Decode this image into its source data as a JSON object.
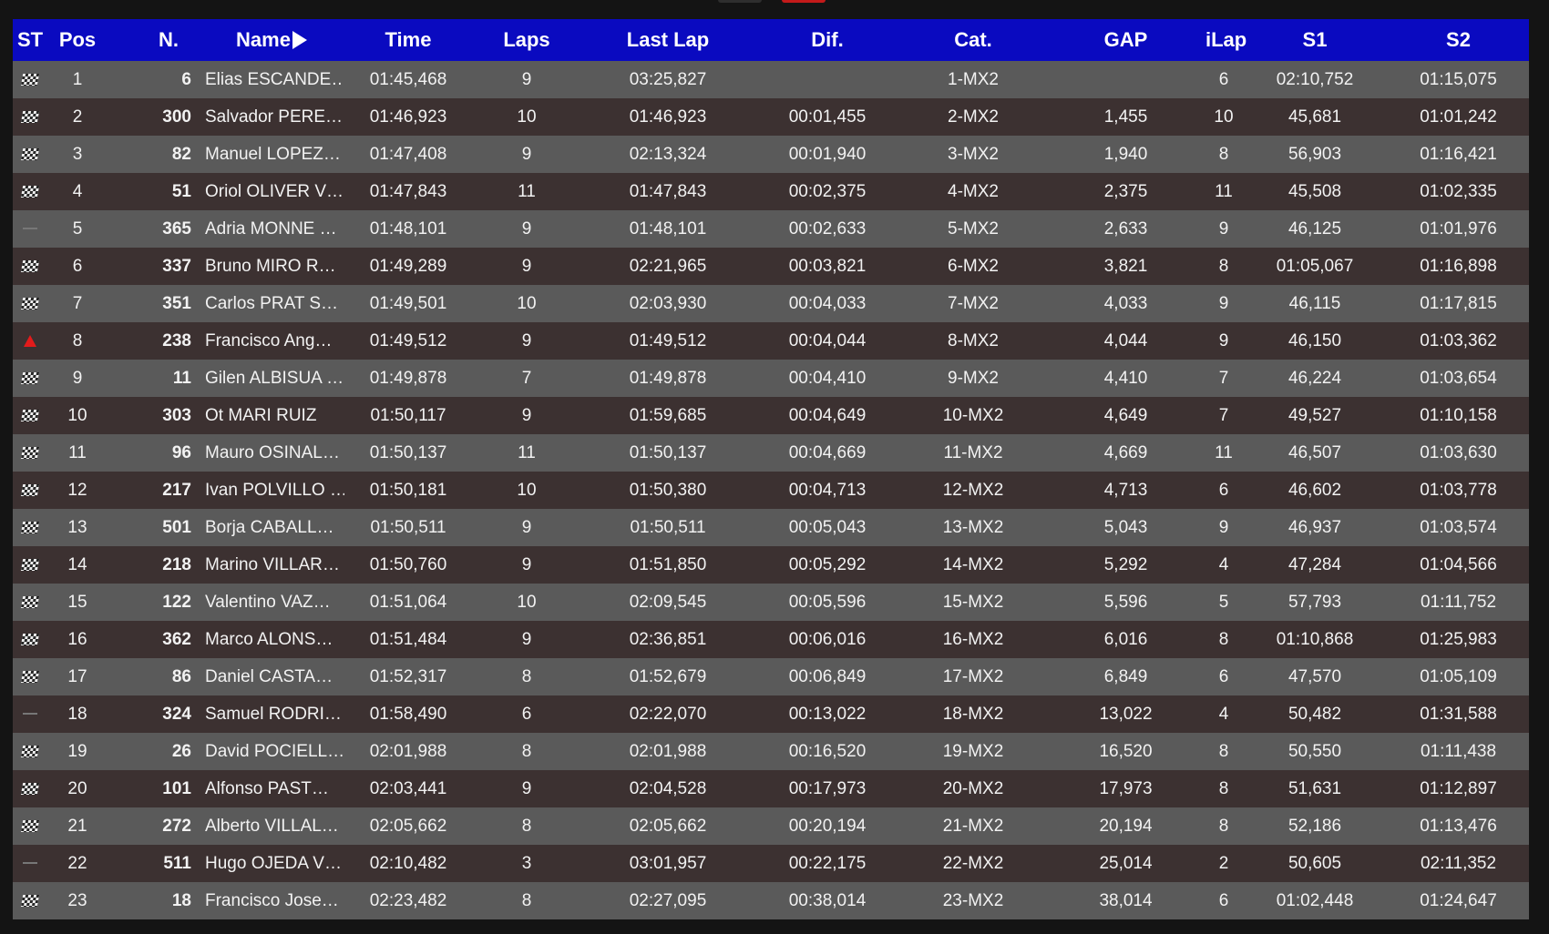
{
  "columns": {
    "st": "ST",
    "pos": "Pos",
    "num": "N.",
    "name": "Name",
    "time": "Time",
    "laps": "Laps",
    "lastlap": "Last Lap",
    "dif": "Dif.",
    "cat": "Cat.",
    "gap": "GAP",
    "ilap": "iLap",
    "s1": "S1",
    "s2": "S2"
  },
  "sort": {
    "column": "name",
    "icon": "sort-arrow-right-icon"
  },
  "colors": {
    "header_bg": "#0a0ac0",
    "row_light": "#5a5a5a",
    "row_dark": "#3c3131",
    "up_arrow": "#e31b1b"
  },
  "rows": [
    {
      "st": "flag",
      "pos": "1",
      "num": "6",
      "name": "Elias ESCANDE…",
      "time": "01:45,468",
      "laps": "9",
      "lastlap": "03:25,827",
      "dif": "",
      "cat": "1-MX2",
      "gap": "",
      "ilap": "6",
      "s1": "02:10,752",
      "s2": "01:15,075"
    },
    {
      "st": "flag",
      "pos": "2",
      "num": "300",
      "name": "Salvador PERE…",
      "time": "01:46,923",
      "laps": "10",
      "lastlap": "01:46,923",
      "dif": "00:01,455",
      "cat": "2-MX2",
      "gap": "1,455",
      "ilap": "10",
      "s1": "45,681",
      "s2": "01:01,242"
    },
    {
      "st": "flag",
      "pos": "3",
      "num": "82",
      "name": "Manuel LOPEZ…",
      "time": "01:47,408",
      "laps": "9",
      "lastlap": "02:13,324",
      "dif": "00:01,940",
      "cat": "3-MX2",
      "gap": "1,940",
      "ilap": "8",
      "s1": "56,903",
      "s2": "01:16,421"
    },
    {
      "st": "flag",
      "pos": "4",
      "num": "51",
      "name": "Oriol OLIVER V…",
      "time": "01:47,843",
      "laps": "11",
      "lastlap": "01:47,843",
      "dif": "00:02,375",
      "cat": "4-MX2",
      "gap": "2,375",
      "ilap": "11",
      "s1": "45,508",
      "s2": "01:02,335"
    },
    {
      "st": "dash",
      "pos": "5",
      "num": "365",
      "name": "Adria MONNE …",
      "time": "01:48,101",
      "laps": "9",
      "lastlap": "01:48,101",
      "dif": "00:02,633",
      "cat": "5-MX2",
      "gap": "2,633",
      "ilap": "9",
      "s1": "46,125",
      "s2": "01:01,976"
    },
    {
      "st": "flag",
      "pos": "6",
      "num": "337",
      "name": "Bruno MIRO R…",
      "time": "01:49,289",
      "laps": "9",
      "lastlap": "02:21,965",
      "dif": "00:03,821",
      "cat": "6-MX2",
      "gap": "3,821",
      "ilap": "8",
      "s1": "01:05,067",
      "s2": "01:16,898"
    },
    {
      "st": "flag",
      "pos": "7",
      "num": "351",
      "name": "Carlos PRAT S…",
      "time": "01:49,501",
      "laps": "10",
      "lastlap": "02:03,930",
      "dif": "00:04,033",
      "cat": "7-MX2",
      "gap": "4,033",
      "ilap": "9",
      "s1": "46,115",
      "s2": "01:17,815"
    },
    {
      "st": "up",
      "pos": "8",
      "num": "238",
      "name": "Francisco Ang…",
      "time": "01:49,512",
      "laps": "9",
      "lastlap": "01:49,512",
      "dif": "00:04,044",
      "cat": "8-MX2",
      "gap": "4,044",
      "ilap": "9",
      "s1": "46,150",
      "s2": "01:03,362"
    },
    {
      "st": "flag",
      "pos": "9",
      "num": "11",
      "name": "Gilen ALBISUA …",
      "time": "01:49,878",
      "laps": "7",
      "lastlap": "01:49,878",
      "dif": "00:04,410",
      "cat": "9-MX2",
      "gap": "4,410",
      "ilap": "7",
      "s1": "46,224",
      "s2": "01:03,654"
    },
    {
      "st": "flag",
      "pos": "10",
      "num": "303",
      "name": "Ot MARI RUIZ",
      "time": "01:50,117",
      "laps": "9",
      "lastlap": "01:59,685",
      "dif": "00:04,649",
      "cat": "10-MX2",
      "gap": "4,649",
      "ilap": "7",
      "s1": "49,527",
      "s2": "01:10,158"
    },
    {
      "st": "flag",
      "pos": "11",
      "num": "96",
      "name": "Mauro OSINAL…",
      "time": "01:50,137",
      "laps": "11",
      "lastlap": "01:50,137",
      "dif": "00:04,669",
      "cat": "11-MX2",
      "gap": "4,669",
      "ilap": "11",
      "s1": "46,507",
      "s2": "01:03,630"
    },
    {
      "st": "flag",
      "pos": "12",
      "num": "217",
      "name": "Ivan POLVILLO …",
      "time": "01:50,181",
      "laps": "10",
      "lastlap": "01:50,380",
      "dif": "00:04,713",
      "cat": "12-MX2",
      "gap": "4,713",
      "ilap": "6",
      "s1": "46,602",
      "s2": "01:03,778"
    },
    {
      "st": "flag",
      "pos": "13",
      "num": "501",
      "name": "Borja CABALL…",
      "time": "01:50,511",
      "laps": "9",
      "lastlap": "01:50,511",
      "dif": "00:05,043",
      "cat": "13-MX2",
      "gap": "5,043",
      "ilap": "9",
      "s1": "46,937",
      "s2": "01:03,574"
    },
    {
      "st": "flag",
      "pos": "14",
      "num": "218",
      "name": "Marino VILLAR…",
      "time": "01:50,760",
      "laps": "9",
      "lastlap": "01:51,850",
      "dif": "00:05,292",
      "cat": "14-MX2",
      "gap": "5,292",
      "ilap": "4",
      "s1": "47,284",
      "s2": "01:04,566"
    },
    {
      "st": "flag",
      "pos": "15",
      "num": "122",
      "name": "Valentino VAZ…",
      "time": "01:51,064",
      "laps": "10",
      "lastlap": "02:09,545",
      "dif": "00:05,596",
      "cat": "15-MX2",
      "gap": "5,596",
      "ilap": "5",
      "s1": "57,793",
      "s2": "01:11,752"
    },
    {
      "st": "flag",
      "pos": "16",
      "num": "362",
      "name": "Marco ALONS…",
      "time": "01:51,484",
      "laps": "9",
      "lastlap": "02:36,851",
      "dif": "00:06,016",
      "cat": "16-MX2",
      "gap": "6,016",
      "ilap": "8",
      "s1": "01:10,868",
      "s2": "01:25,983"
    },
    {
      "st": "flag",
      "pos": "17",
      "num": "86",
      "name": "Daniel CASTA…",
      "time": "01:52,317",
      "laps": "8",
      "lastlap": "01:52,679",
      "dif": "00:06,849",
      "cat": "17-MX2",
      "gap": "6,849",
      "ilap": "6",
      "s1": "47,570",
      "s2": "01:05,109"
    },
    {
      "st": "dash",
      "pos": "18",
      "num": "324",
      "name": "Samuel RODRI…",
      "time": "01:58,490",
      "laps": "6",
      "lastlap": "02:22,070",
      "dif": "00:13,022",
      "cat": "18-MX2",
      "gap": "13,022",
      "ilap": "4",
      "s1": "50,482",
      "s2": "01:31,588"
    },
    {
      "st": "flag",
      "pos": "19",
      "num": "26",
      "name": "David POCIELL…",
      "time": "02:01,988",
      "laps": "8",
      "lastlap": "02:01,988",
      "dif": "00:16,520",
      "cat": "19-MX2",
      "gap": "16,520",
      "ilap": "8",
      "s1": "50,550",
      "s2": "01:11,438"
    },
    {
      "st": "flag",
      "pos": "20",
      "num": "101",
      "name": "Alfonso PAST…",
      "time": "02:03,441",
      "laps": "9",
      "lastlap": "02:04,528",
      "dif": "00:17,973",
      "cat": "20-MX2",
      "gap": "17,973",
      "ilap": "8",
      "s1": "51,631",
      "s2": "01:12,897"
    },
    {
      "st": "flag",
      "pos": "21",
      "num": "272",
      "name": "Alberto VILLAL…",
      "time": "02:05,662",
      "laps": "8",
      "lastlap": "02:05,662",
      "dif": "00:20,194",
      "cat": "21-MX2",
      "gap": "20,194",
      "ilap": "8",
      "s1": "52,186",
      "s2": "01:13,476"
    },
    {
      "st": "dash",
      "pos": "22",
      "num": "511",
      "name": "Hugo OJEDA V…",
      "time": "02:10,482",
      "laps": "3",
      "lastlap": "03:01,957",
      "dif": "00:22,175",
      "cat": "22-MX2",
      "gap": "25,014",
      "ilap": "2",
      "s1": "50,605",
      "s2": "02:11,352"
    },
    {
      "st": "flag",
      "pos": "23",
      "num": "18",
      "name": "Francisco Jose…",
      "time": "02:23,482",
      "laps": "8",
      "lastlap": "02:27,095",
      "dif": "00:38,014",
      "cat": "23-MX2",
      "gap": "38,014",
      "ilap": "6",
      "s1": "01:02,448",
      "s2": "01:24,647"
    }
  ]
}
